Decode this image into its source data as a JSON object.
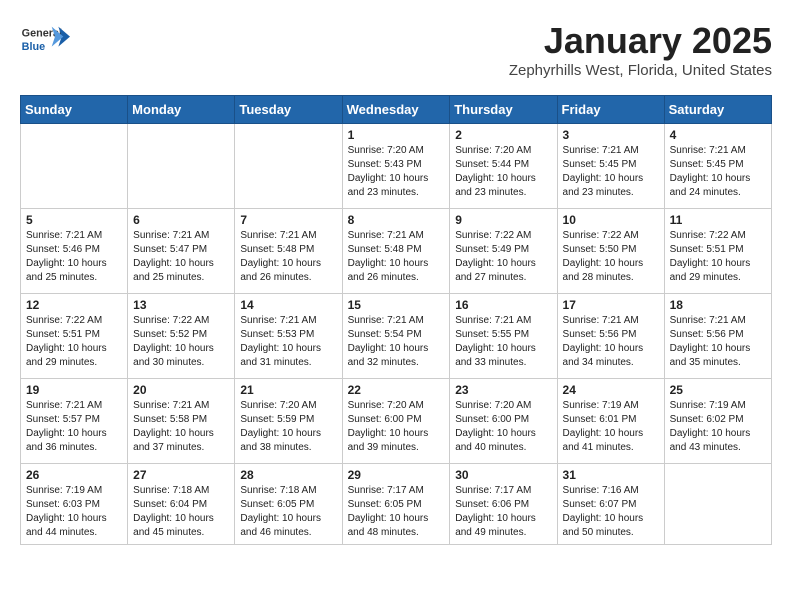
{
  "header": {
    "logo_general": "General",
    "logo_blue": "Blue",
    "month": "January 2025",
    "location": "Zephyrhills West, Florida, United States"
  },
  "weekdays": [
    "Sunday",
    "Monday",
    "Tuesday",
    "Wednesday",
    "Thursday",
    "Friday",
    "Saturday"
  ],
  "weeks": [
    [
      {
        "day": "",
        "info": ""
      },
      {
        "day": "",
        "info": ""
      },
      {
        "day": "",
        "info": ""
      },
      {
        "day": "1",
        "info": "Sunrise: 7:20 AM\nSunset: 5:43 PM\nDaylight: 10 hours\nand 23 minutes."
      },
      {
        "day": "2",
        "info": "Sunrise: 7:20 AM\nSunset: 5:44 PM\nDaylight: 10 hours\nand 23 minutes."
      },
      {
        "day": "3",
        "info": "Sunrise: 7:21 AM\nSunset: 5:45 PM\nDaylight: 10 hours\nand 23 minutes."
      },
      {
        "day": "4",
        "info": "Sunrise: 7:21 AM\nSunset: 5:45 PM\nDaylight: 10 hours\nand 24 minutes."
      }
    ],
    [
      {
        "day": "5",
        "info": "Sunrise: 7:21 AM\nSunset: 5:46 PM\nDaylight: 10 hours\nand 25 minutes."
      },
      {
        "day": "6",
        "info": "Sunrise: 7:21 AM\nSunset: 5:47 PM\nDaylight: 10 hours\nand 25 minutes."
      },
      {
        "day": "7",
        "info": "Sunrise: 7:21 AM\nSunset: 5:48 PM\nDaylight: 10 hours\nand 26 minutes."
      },
      {
        "day": "8",
        "info": "Sunrise: 7:21 AM\nSunset: 5:48 PM\nDaylight: 10 hours\nand 26 minutes."
      },
      {
        "day": "9",
        "info": "Sunrise: 7:22 AM\nSunset: 5:49 PM\nDaylight: 10 hours\nand 27 minutes."
      },
      {
        "day": "10",
        "info": "Sunrise: 7:22 AM\nSunset: 5:50 PM\nDaylight: 10 hours\nand 28 minutes."
      },
      {
        "day": "11",
        "info": "Sunrise: 7:22 AM\nSunset: 5:51 PM\nDaylight: 10 hours\nand 29 minutes."
      }
    ],
    [
      {
        "day": "12",
        "info": "Sunrise: 7:22 AM\nSunset: 5:51 PM\nDaylight: 10 hours\nand 29 minutes."
      },
      {
        "day": "13",
        "info": "Sunrise: 7:22 AM\nSunset: 5:52 PM\nDaylight: 10 hours\nand 30 minutes."
      },
      {
        "day": "14",
        "info": "Sunrise: 7:21 AM\nSunset: 5:53 PM\nDaylight: 10 hours\nand 31 minutes."
      },
      {
        "day": "15",
        "info": "Sunrise: 7:21 AM\nSunset: 5:54 PM\nDaylight: 10 hours\nand 32 minutes."
      },
      {
        "day": "16",
        "info": "Sunrise: 7:21 AM\nSunset: 5:55 PM\nDaylight: 10 hours\nand 33 minutes."
      },
      {
        "day": "17",
        "info": "Sunrise: 7:21 AM\nSunset: 5:56 PM\nDaylight: 10 hours\nand 34 minutes."
      },
      {
        "day": "18",
        "info": "Sunrise: 7:21 AM\nSunset: 5:56 PM\nDaylight: 10 hours\nand 35 minutes."
      }
    ],
    [
      {
        "day": "19",
        "info": "Sunrise: 7:21 AM\nSunset: 5:57 PM\nDaylight: 10 hours\nand 36 minutes."
      },
      {
        "day": "20",
        "info": "Sunrise: 7:21 AM\nSunset: 5:58 PM\nDaylight: 10 hours\nand 37 minutes."
      },
      {
        "day": "21",
        "info": "Sunrise: 7:20 AM\nSunset: 5:59 PM\nDaylight: 10 hours\nand 38 minutes."
      },
      {
        "day": "22",
        "info": "Sunrise: 7:20 AM\nSunset: 6:00 PM\nDaylight: 10 hours\nand 39 minutes."
      },
      {
        "day": "23",
        "info": "Sunrise: 7:20 AM\nSunset: 6:00 PM\nDaylight: 10 hours\nand 40 minutes."
      },
      {
        "day": "24",
        "info": "Sunrise: 7:19 AM\nSunset: 6:01 PM\nDaylight: 10 hours\nand 41 minutes."
      },
      {
        "day": "25",
        "info": "Sunrise: 7:19 AM\nSunset: 6:02 PM\nDaylight: 10 hours\nand 43 minutes."
      }
    ],
    [
      {
        "day": "26",
        "info": "Sunrise: 7:19 AM\nSunset: 6:03 PM\nDaylight: 10 hours\nand 44 minutes."
      },
      {
        "day": "27",
        "info": "Sunrise: 7:18 AM\nSunset: 6:04 PM\nDaylight: 10 hours\nand 45 minutes."
      },
      {
        "day": "28",
        "info": "Sunrise: 7:18 AM\nSunset: 6:05 PM\nDaylight: 10 hours\nand 46 minutes."
      },
      {
        "day": "29",
        "info": "Sunrise: 7:17 AM\nSunset: 6:05 PM\nDaylight: 10 hours\nand 48 minutes."
      },
      {
        "day": "30",
        "info": "Sunrise: 7:17 AM\nSunset: 6:06 PM\nDaylight: 10 hours\nand 49 minutes."
      },
      {
        "day": "31",
        "info": "Sunrise: 7:16 AM\nSunset: 6:07 PM\nDaylight: 10 hours\nand 50 minutes."
      },
      {
        "day": "",
        "info": ""
      }
    ]
  ]
}
